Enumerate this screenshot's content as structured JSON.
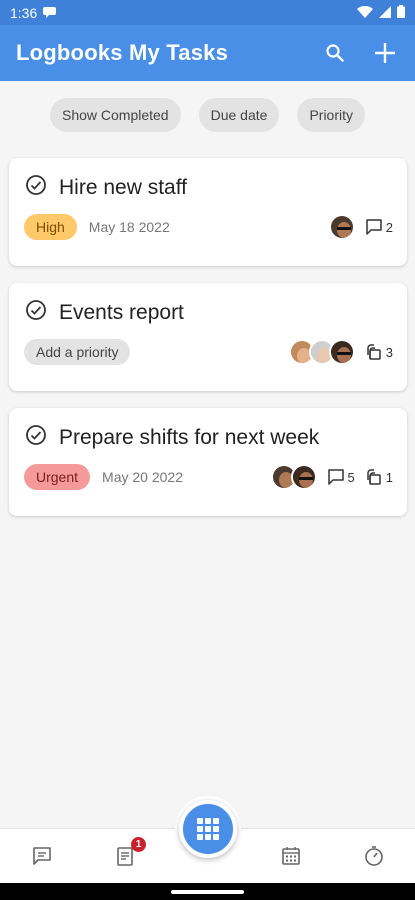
{
  "status_bar": {
    "time": "1:36"
  },
  "app_bar": {
    "title": "Logbooks My Tasks"
  },
  "filters": [
    {
      "label": "Show Completed"
    },
    {
      "label": "Due date"
    },
    {
      "label": "Priority"
    }
  ],
  "tasks": [
    {
      "title": "Hire new staff",
      "priority": "High",
      "priority_color": "#ffc868",
      "date": "May 18 2022",
      "comments": "2",
      "attachments": ""
    },
    {
      "title": "Events report",
      "priority": "Add a priority",
      "priority_color": "#e3e3e3",
      "date": "",
      "comments": "",
      "attachments": "3"
    },
    {
      "title": "Prepare shifts for next week",
      "priority": "Urgent",
      "priority_color": "#f59a9a",
      "date": "May 20 2022",
      "comments": "5",
      "attachments": "1"
    }
  ],
  "bottom_nav": {
    "notifications_badge": "1"
  },
  "colors": {
    "primary": "#4a8fe7",
    "status_bar": "#3f80d8",
    "badge_red": "#c8232c"
  },
  "icons": [
    "search-icon",
    "plus-icon",
    "check-circle-icon",
    "comment-icon",
    "attachment-icon",
    "chat-icon",
    "document-icon",
    "grid-icon",
    "calendar-icon",
    "timer-icon"
  ]
}
